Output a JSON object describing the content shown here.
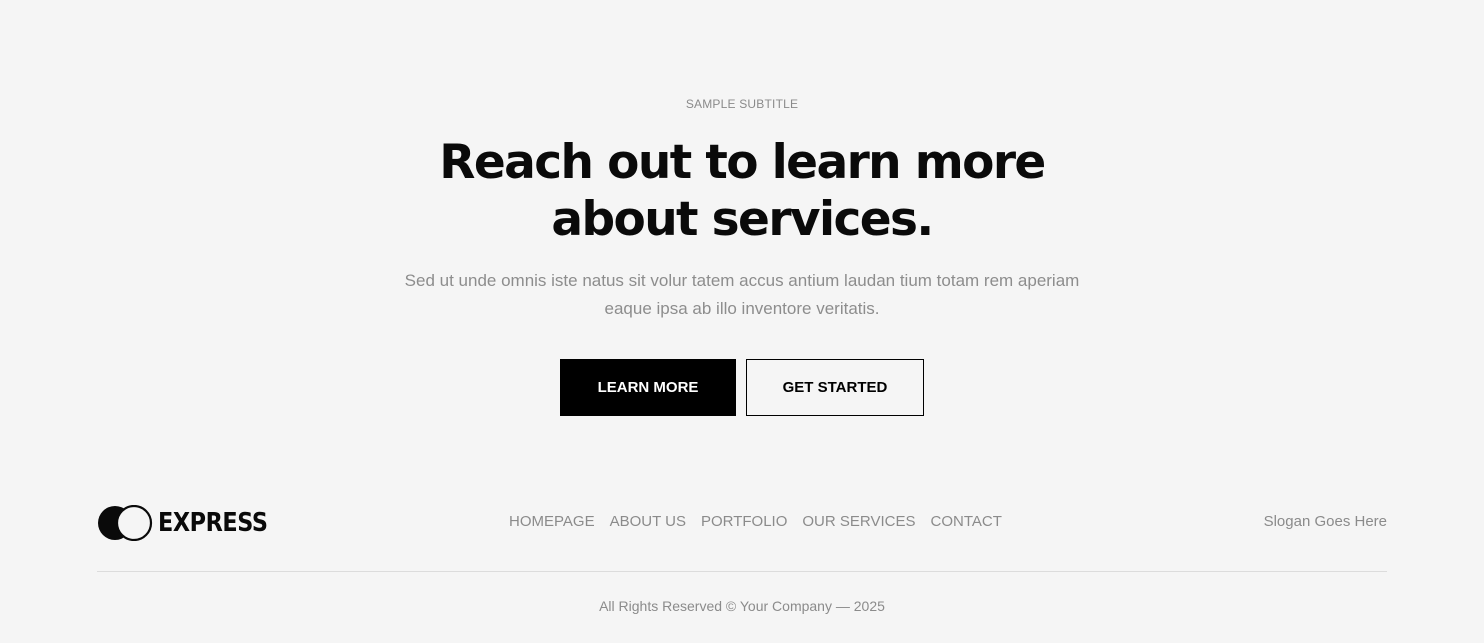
{
  "hero": {
    "subtitle": "SAMPLE SUBTITLE",
    "headline_line1": "Reach out to learn more",
    "headline_line2": "about services.",
    "description_line1": "Sed ut unde omnis iste natus sit volur tatem accus antium laudan tium totam rem aperiam",
    "description_line2": "eaque ipsa ab illo inventore veritatis.",
    "primary_button": "LEARN MORE",
    "secondary_button": "GET STARTED"
  },
  "footer": {
    "logo_text": "EXPRESS",
    "nav": [
      "HOMEPAGE",
      "ABOUT US",
      "PORTFOLIO",
      "OUR SERVICES",
      "CONTACT"
    ],
    "slogan": "Slogan Goes Here",
    "copyright": "All Rights Reserved © Your Company — 2025"
  },
  "colors": {
    "background": "#f5f5f5",
    "text_primary": "#0a0a0a",
    "text_muted": "#8b8b8b",
    "button_dark": "#000000",
    "divider": "#dcdcdc"
  },
  "icons": {
    "logo_mark": "two-overlapping-circles-icon"
  }
}
